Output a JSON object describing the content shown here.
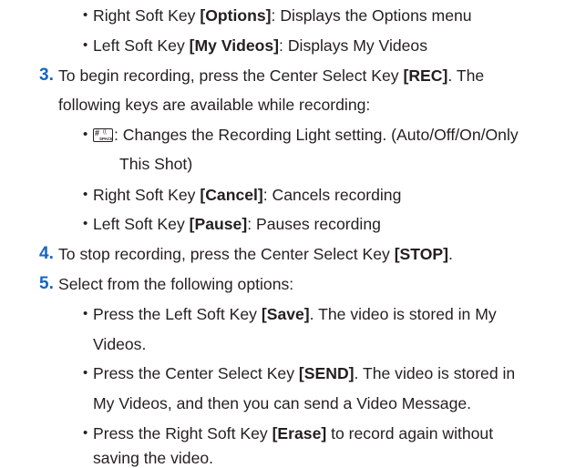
{
  "bullet_glyph": "•",
  "items": [
    {
      "id": "right-options",
      "before": "Right Soft Key ",
      "key": "[Options]",
      "after": ": Displays the Options menu"
    },
    {
      "id": "left-myvideos",
      "before": "Left Soft Key ",
      "key": "[My Videos]",
      "after": ": Displays My Videos"
    },
    {
      "id": "step3",
      "num": "3.",
      "before": "To begin recording, press the Center Select Key ",
      "key": "[REC]",
      "after": ". The",
      "cont": "following keys are available while recording:"
    },
    {
      "id": "recording-light",
      "icon_label": "#SPACE",
      "text": ": Changes the Recording Light setting. (Auto/Off/On/Only",
      "cont": "This Shot)"
    },
    {
      "id": "right-cancel",
      "before": "Right Soft Key ",
      "key": "[Cancel]",
      "after": ": Cancels recording"
    },
    {
      "id": "left-pause",
      "before": "Left Soft Key ",
      "key": "[Pause]",
      "after": ": Pauses recording"
    },
    {
      "id": "step4",
      "num": "4.",
      "before": "To stop recording, press the Center Select Key ",
      "key": "[STOP]",
      "after": "."
    },
    {
      "id": "step5",
      "num": "5.",
      "text": "Select from the following options:"
    },
    {
      "id": "opt-save",
      "before": "Press the Left Soft Key ",
      "key": "[Save]",
      "after": ". The video is stored in My",
      "cont": "Videos."
    },
    {
      "id": "opt-send",
      "before": "Press the Center Select Key ",
      "key": "[SEND]",
      "after": ". The video is stored in",
      "cont": "My Videos, and then you can send a Video Message."
    },
    {
      "id": "opt-erase",
      "before": "Press the Right Soft Key ",
      "key": "[Erase]",
      "after": " to record again without",
      "cont": "saving the video."
    }
  ]
}
